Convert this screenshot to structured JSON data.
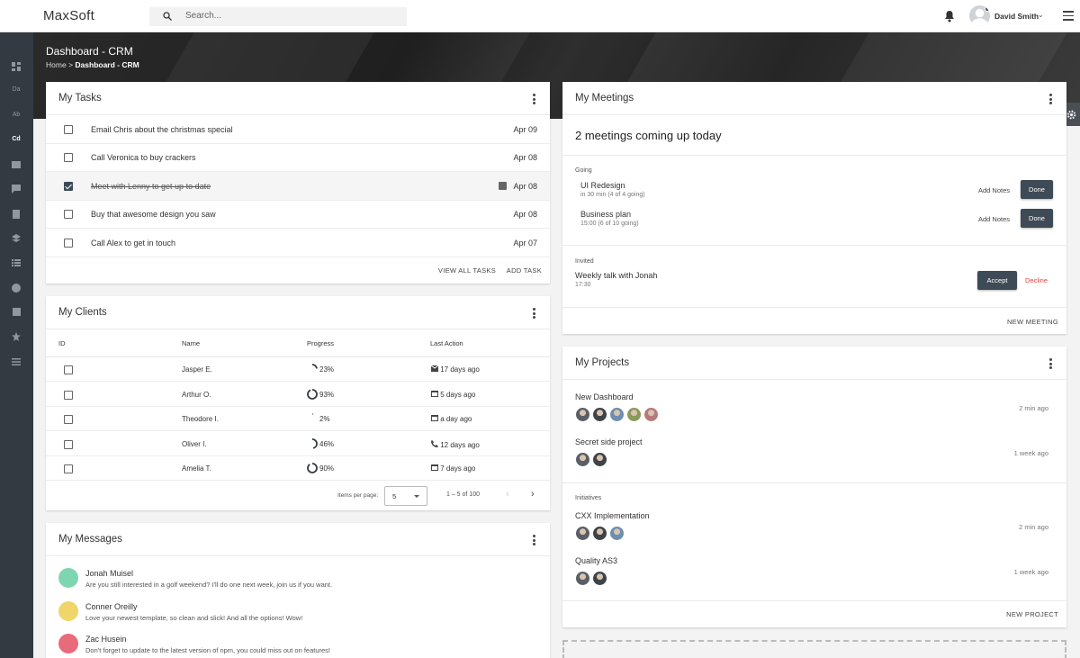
{
  "app": {
    "logo": "MaxSoft"
  },
  "search": {
    "placeholder": "Search..."
  },
  "user": {
    "name": "David Smith"
  },
  "sidebar": {
    "items": [
      {
        "icon": "dashboard-icon",
        "label": ""
      },
      {
        "icon": "text",
        "label": "Da"
      },
      {
        "icon": "text",
        "label": "Ab"
      },
      {
        "icon": "text",
        "label": "Cd"
      },
      {
        "icon": "mail-icon",
        "label": ""
      },
      {
        "icon": "chat-icon",
        "label": ""
      },
      {
        "icon": "clipboard-icon",
        "label": ""
      },
      {
        "icon": "layers-icon",
        "label": ""
      },
      {
        "icon": "list-icon",
        "label": ""
      },
      {
        "icon": "account-icon",
        "label": ""
      },
      {
        "icon": "book-icon",
        "label": ""
      },
      {
        "icon": "star-icon",
        "label": ""
      },
      {
        "icon": "menu-icon",
        "label": ""
      }
    ]
  },
  "page": {
    "title": "Dashboard - CRM",
    "crumb_home": "Home",
    "crumb_sep": ">",
    "crumb_current": "Dashboard - CRM"
  },
  "tasks": {
    "title": "My Tasks",
    "items": [
      {
        "text": "Email Chris about the christmas special",
        "date": "Apr 09",
        "done": false
      },
      {
        "text": "Call Veronica to buy crackers",
        "date": "Apr 08",
        "done": false
      },
      {
        "text": "Meet with Lenny to get up to date",
        "date": "Apr 08",
        "done": true
      },
      {
        "text": "Buy that awesome design you saw",
        "date": "Apr 08",
        "done": false
      },
      {
        "text": "Call Alex to get in touch",
        "date": "Apr 07",
        "done": false
      }
    ],
    "view_all": "VIEW ALL TASKS",
    "add": "ADD TASK"
  },
  "clients": {
    "title": "My Clients",
    "columns": [
      "ID",
      "Name",
      "Progress",
      "Last Action"
    ],
    "rows": [
      {
        "name": "Jasper E.",
        "progress": 23,
        "progress_label": "23%",
        "action_icon": "mail-icon",
        "action": "17 days ago"
      },
      {
        "name": "Arthur O.",
        "progress": 93,
        "progress_label": "93%",
        "action_icon": "calendar-icon",
        "action": "5 days ago"
      },
      {
        "name": "Theodore I.",
        "progress": 2,
        "progress_label": "2%",
        "action_icon": "calendar-icon",
        "action": "a day ago"
      },
      {
        "name": "Oliver I.",
        "progress": 46,
        "progress_label": "46%",
        "action_icon": "phone-icon",
        "action": "12 days ago"
      },
      {
        "name": "Amelia T.",
        "progress": 90,
        "progress_label": "90%",
        "action_icon": "calendar-icon",
        "action": "7 days ago"
      }
    ],
    "items_per_page_label": "Items per page:",
    "items_per_page": "5",
    "range": "1 – 5 of 100"
  },
  "messages": {
    "title": "My Messages",
    "items": [
      {
        "name": "Jonah Muisel",
        "text": "Are you still interested in a golf weekend? I'll do one next week, join us if you want.",
        "color": "#7ed6b0"
      },
      {
        "name": "Conner Oreilly",
        "text": "Love your newest template, so clean and slick! And all the options! Wow!",
        "color": "#f0d56a"
      },
      {
        "name": "Zac Husein",
        "text": "Don't forget to update to the latest version of npm, you could miss out on features!",
        "color": "#e86b7a"
      }
    ]
  },
  "meetings": {
    "title": "My Meetings",
    "summary": "2 meetings coming up today",
    "going_label": "Going",
    "going": [
      {
        "name": "UI Redesign",
        "meta": "in 30 min (4 of 4 going)",
        "notes": "Add Notes",
        "done": "Done"
      },
      {
        "name": "Business plan",
        "meta": "15:00 (6 of 10 going)",
        "notes": "Add Notes",
        "done": "Done"
      }
    ],
    "invited_label": "Invited",
    "invited": {
      "name": "Weekly talk with Jonah",
      "meta": "17:30",
      "accept": "Accept",
      "decline": "Decline"
    },
    "new": "NEW MEETING",
    "decline_color": "#e0443c"
  },
  "projects": {
    "title": "My Projects",
    "items": [
      {
        "name": "New Dashboard",
        "time": "2 min ago",
        "avatars": 5
      },
      {
        "name": "Secret side project",
        "time": "1 week ago",
        "avatars": 2
      }
    ],
    "initiatives_label": "Initiatives",
    "initiatives": [
      {
        "name": "CXX Implementation",
        "time": "2 min ago",
        "avatars": 3
      },
      {
        "name": "Quality AS3",
        "time": "1 week ago",
        "avatars": 2
      }
    ],
    "new": "NEW PROJECT"
  }
}
